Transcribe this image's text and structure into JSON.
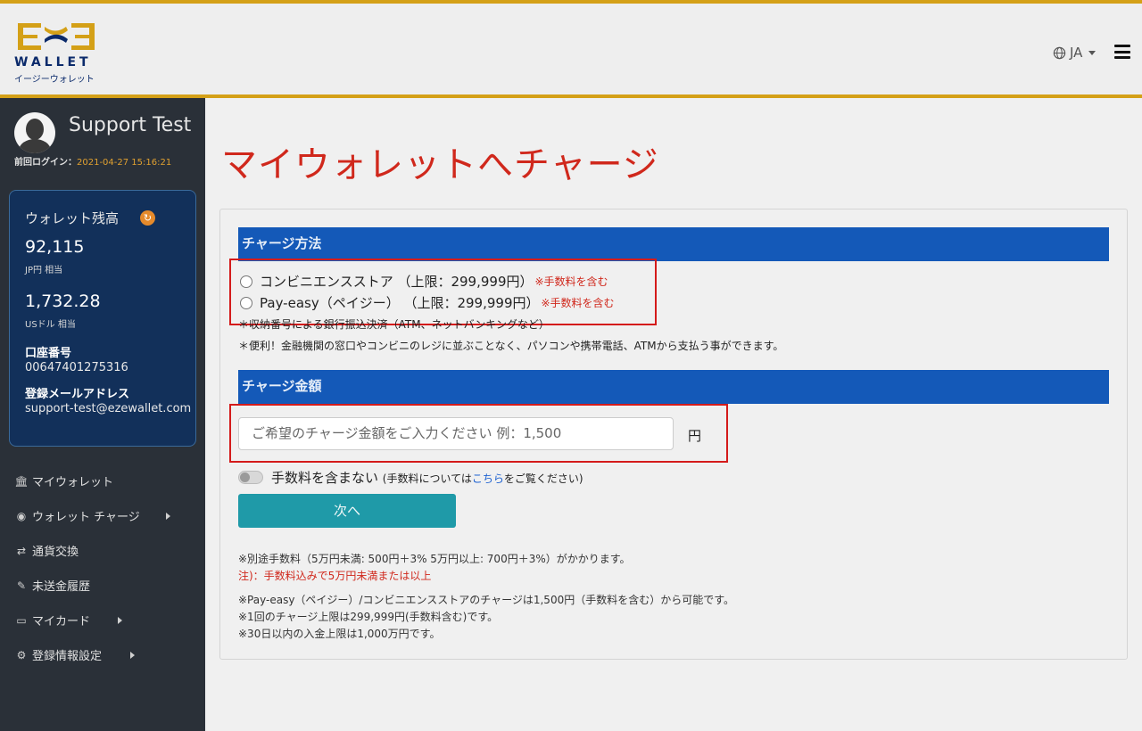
{
  "header": {
    "logo_wallet": "WALLET",
    "logo_sub": "イージーウォレット",
    "language": "JA"
  },
  "sidebar": {
    "user_name": "Support Test",
    "last_login_label": "前回ログイン：",
    "last_login_time": "2021-04-27 15:16:21",
    "wallet": {
      "title": "ウォレット残高",
      "jpy_amount": "92,115",
      "jpy_sub": "JP円 相当",
      "usd_amount": "1,732.28",
      "usd_sub": "USドル 相当",
      "account_label": "口座番号",
      "account_number": "00647401275316",
      "email_label": "登録メールアドレス",
      "email": "support-test@ezewallet.com"
    },
    "nav": [
      {
        "label": "マイウォレット",
        "icon": "bank-icon"
      },
      {
        "label": "ウォレット チャージ",
        "icon": "coin-icon"
      },
      {
        "label": "通貨交換",
        "icon": "exchange-icon"
      },
      {
        "label": "未送金履歴",
        "icon": "history-icon"
      },
      {
        "label": "マイカード",
        "icon": "card-icon"
      },
      {
        "label": "登録情報設定",
        "icon": "gear-icon"
      }
    ]
  },
  "main": {
    "title": "マイウォレットへチャージ",
    "method_header": "チャージ方法",
    "options": [
      {
        "label": "コンビニエンスストア （上限：299,999円）",
        "fee": "※手数料を含む"
      },
      {
        "label": "Pay-easy（ペイジー） （上限：299,999円）",
        "fee": "※手数料を含む"
      }
    ],
    "note1": "＊収納番号による銀行振込決済（ATM、ネットバンキングなど）",
    "note2": "＊便利！金融機関の窓口やコンビニのレジに並ぶことなく、パソコンや携帯電話、ATMから支払う事ができます。",
    "amount_header": "チャージ金額",
    "amount_placeholder": "ご希望のチャージ金額をご入力ください 例：1,500",
    "yen": "円",
    "toggle_label": "手数料を含まない",
    "toggle_note_pre": "(手数料については",
    "toggle_note_link": "こちら",
    "toggle_note_post": "をご覧ください)",
    "next_button": "次へ",
    "fee_note": "※別途手数料（5万円未満: 500円＋3% 5万円以上: 700円＋3%）がかかります。",
    "fee_warning": "注)：手数料込みで5万円未満または以上",
    "info1": "※Pay-easy（ペイジー）/コンビニエンスストアのチャージは1,500円（手数料を含む）から可能です。",
    "info2": "※1回のチャージ上限は299,999円(手数料含む)です。",
    "info3": "※30日以内の入金上限は1,000万円です。"
  },
  "colors": {
    "accent_gold": "#d4a017",
    "title_red": "#d0281c",
    "section_blue": "#1459b8",
    "button_teal": "#1f9aa8",
    "sidebar_bg": "#2a3038"
  }
}
